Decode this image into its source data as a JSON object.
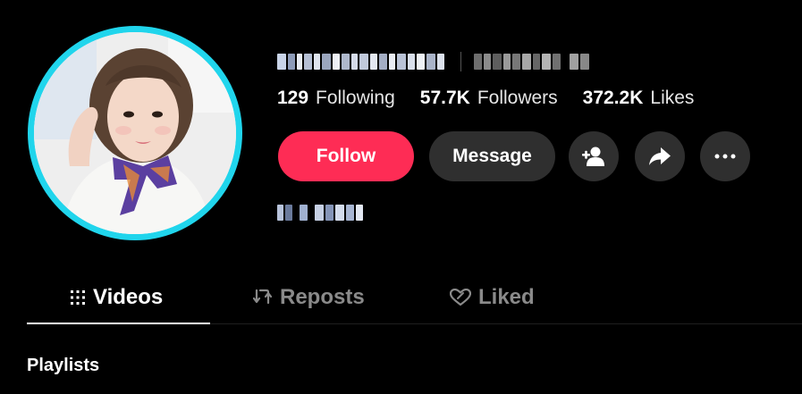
{
  "profile": {
    "username_redacted": true,
    "nickname_redacted": true,
    "stats": [
      {
        "count": "129",
        "label": "Following"
      },
      {
        "count": "57.7K",
        "label": "Followers"
      },
      {
        "count": "372.2K",
        "label": "Likes"
      }
    ],
    "bio_redacted": true
  },
  "actions": {
    "follow_label": "Follow",
    "message_label": "Message",
    "add_friend_icon": "add-user-icon",
    "share_icon": "share-icon",
    "more_icon": "more-icon"
  },
  "tabs": [
    {
      "label": "Videos",
      "icon": "grid-icon",
      "active": true
    },
    {
      "label": "Reposts",
      "icon": "repost-icon",
      "active": false
    },
    {
      "label": "Liked",
      "icon": "heart-icon",
      "active": false
    }
  ],
  "sections": {
    "playlists_title": "Playlists"
  },
  "colors": {
    "accent": "#fe2c55",
    "avatar_ring": "#20d5ec",
    "button_dark": "#2f2f2f",
    "background": "#000000"
  }
}
